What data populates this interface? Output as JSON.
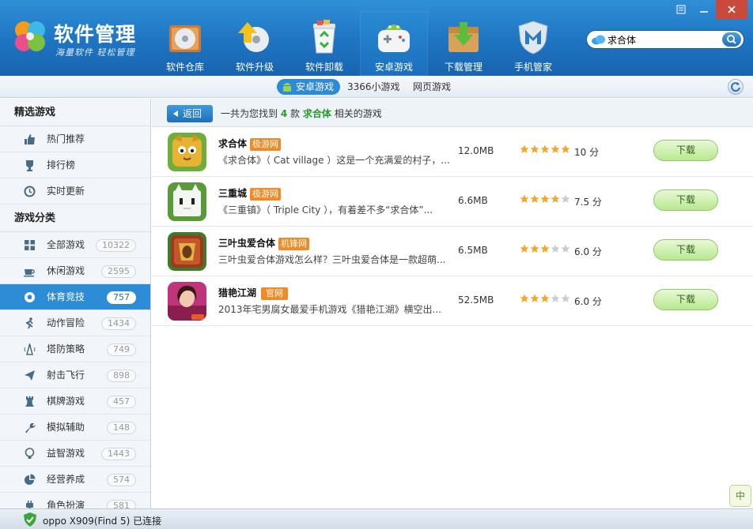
{
  "brand": {
    "title": "软件管理",
    "subtitle": "海量软件 轻松管理"
  },
  "nav": [
    {
      "label": "软件仓库",
      "icon": "disc-box-icon"
    },
    {
      "label": "软件升级",
      "icon": "upgrade-arrow-icon"
    },
    {
      "label": "软件卸载",
      "icon": "recycle-bin-icon"
    },
    {
      "label": "安卓游戏",
      "icon": "android-game-icon",
      "active": true
    },
    {
      "label": "下载管理",
      "icon": "download-box-icon"
    },
    {
      "label": "手机管家",
      "icon": "shield-m-icon"
    }
  ],
  "search": {
    "value": "求合体"
  },
  "subnav": {
    "tabs": [
      "安卓游戏",
      "3366小游戏",
      "网页游戏"
    ]
  },
  "sidebar": {
    "featured_title": "精选游戏",
    "featured": [
      {
        "label": "热门推荐",
        "icon": "thumb-up-icon"
      },
      {
        "label": "排行榜",
        "icon": "trophy-icon"
      },
      {
        "label": "实时更新",
        "icon": "clock-icon"
      }
    ],
    "category_title": "游戏分类",
    "categories": [
      {
        "label": "全部游戏",
        "count": "10322",
        "icon": "grid-icon"
      },
      {
        "label": "休闲游戏",
        "count": "2595",
        "icon": "coffee-icon"
      },
      {
        "label": "体育竞技",
        "count": "757",
        "icon": "soccer-ball-icon",
        "active": true
      },
      {
        "label": "动作冒险",
        "count": "1434",
        "icon": "running-icon"
      },
      {
        "label": "塔防策略",
        "count": "749",
        "icon": "tower-icon"
      },
      {
        "label": "射击飞行",
        "count": "898",
        "icon": "paper-plane-icon"
      },
      {
        "label": "棋牌游戏",
        "count": "457",
        "icon": "chess-rook-icon"
      },
      {
        "label": "模拟辅助",
        "count": "148",
        "icon": "wrench-icon"
      },
      {
        "label": "益智游戏",
        "count": "1443",
        "icon": "lightbulb-icon"
      },
      {
        "label": "经营养成",
        "count": "574",
        "icon": "pie-icon"
      },
      {
        "label": "角色扮演",
        "count": "581",
        "icon": "plug-icon"
      }
    ]
  },
  "results": {
    "back_label": "返回",
    "prefix": "一共为您找到",
    "count": "4",
    "unit": "款",
    "keyword": "求合体",
    "suffix": "相关的游戏"
  },
  "apps": [
    {
      "name": "求合体",
      "source": "极游网",
      "desc": "《求合体》（ Cat village ）这是一个充满爱的村子，...",
      "size": "12.0MB",
      "stars": 5,
      "score": "10 分",
      "download": "下载",
      "icon": "cat-village-icon"
    },
    {
      "name": "三重城",
      "source": "极游网",
      "desc": "《三重镇》（ Triple City ），有着差不多“求合体”...",
      "size": "6.6MB",
      "stars": 4,
      "score": "7.5 分",
      "download": "下载",
      "icon": "triple-city-icon"
    },
    {
      "name": "三叶虫爱合体",
      "source": "机锋网",
      "desc": "三叶虫爱合体游戏怎么样？三叶虫爱合体是一款超萌...",
      "size": "6.5MB",
      "stars": 3,
      "score": "6.0 分",
      "download": "下载",
      "icon": "trilobite-icon"
    },
    {
      "name": "猎艳江湖",
      "source": "官网",
      "desc": "2013年宅男腐女最爱手机游戏《猎艳江湖》横空出...",
      "size": "52.5MB",
      "stars": 3,
      "score": "6.0 分",
      "download": "下载",
      "icon": "heroine-icon"
    }
  ],
  "float_button": "中",
  "status": {
    "text": "oppo X909(Find 5) 已连接"
  },
  "colors": {
    "header": "#1f74c2",
    "accent": "#2e8bd6",
    "star": "#f5a623",
    "download_green": "#b8e88f",
    "tag_orange": "#f08a24"
  }
}
